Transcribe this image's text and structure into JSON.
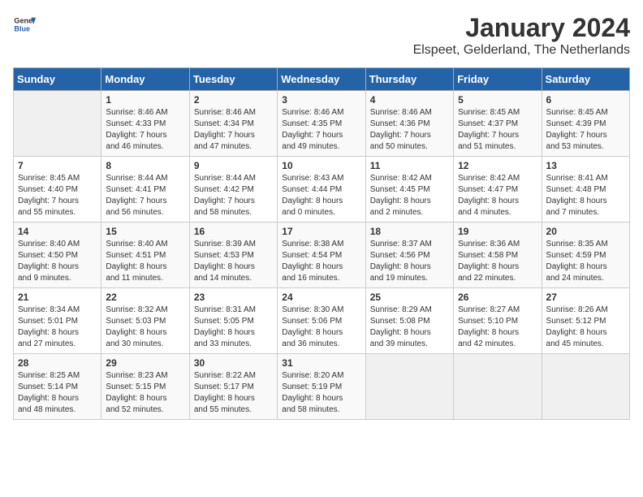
{
  "header": {
    "logo_general": "General",
    "logo_blue": "Blue",
    "month": "January 2024",
    "location": "Elspeet, Gelderland, The Netherlands"
  },
  "days_of_week": [
    "Sunday",
    "Monday",
    "Tuesday",
    "Wednesday",
    "Thursday",
    "Friday",
    "Saturday"
  ],
  "weeks": [
    [
      {
        "day": "",
        "info": ""
      },
      {
        "day": "1",
        "info": "Sunrise: 8:46 AM\nSunset: 4:33 PM\nDaylight: 7 hours\nand 46 minutes."
      },
      {
        "day": "2",
        "info": "Sunrise: 8:46 AM\nSunset: 4:34 PM\nDaylight: 7 hours\nand 47 minutes."
      },
      {
        "day": "3",
        "info": "Sunrise: 8:46 AM\nSunset: 4:35 PM\nDaylight: 7 hours\nand 49 minutes."
      },
      {
        "day": "4",
        "info": "Sunrise: 8:46 AM\nSunset: 4:36 PM\nDaylight: 7 hours\nand 50 minutes."
      },
      {
        "day": "5",
        "info": "Sunrise: 8:45 AM\nSunset: 4:37 PM\nDaylight: 7 hours\nand 51 minutes."
      },
      {
        "day": "6",
        "info": "Sunrise: 8:45 AM\nSunset: 4:39 PM\nDaylight: 7 hours\nand 53 minutes."
      }
    ],
    [
      {
        "day": "7",
        "info": "Sunrise: 8:45 AM\nSunset: 4:40 PM\nDaylight: 7 hours\nand 55 minutes."
      },
      {
        "day": "8",
        "info": "Sunrise: 8:44 AM\nSunset: 4:41 PM\nDaylight: 7 hours\nand 56 minutes."
      },
      {
        "day": "9",
        "info": "Sunrise: 8:44 AM\nSunset: 4:42 PM\nDaylight: 7 hours\nand 58 minutes."
      },
      {
        "day": "10",
        "info": "Sunrise: 8:43 AM\nSunset: 4:44 PM\nDaylight: 8 hours\nand 0 minutes."
      },
      {
        "day": "11",
        "info": "Sunrise: 8:42 AM\nSunset: 4:45 PM\nDaylight: 8 hours\nand 2 minutes."
      },
      {
        "day": "12",
        "info": "Sunrise: 8:42 AM\nSunset: 4:47 PM\nDaylight: 8 hours\nand 4 minutes."
      },
      {
        "day": "13",
        "info": "Sunrise: 8:41 AM\nSunset: 4:48 PM\nDaylight: 8 hours\nand 7 minutes."
      }
    ],
    [
      {
        "day": "14",
        "info": "Sunrise: 8:40 AM\nSunset: 4:50 PM\nDaylight: 8 hours\nand 9 minutes."
      },
      {
        "day": "15",
        "info": "Sunrise: 8:40 AM\nSunset: 4:51 PM\nDaylight: 8 hours\nand 11 minutes."
      },
      {
        "day": "16",
        "info": "Sunrise: 8:39 AM\nSunset: 4:53 PM\nDaylight: 8 hours\nand 14 minutes."
      },
      {
        "day": "17",
        "info": "Sunrise: 8:38 AM\nSunset: 4:54 PM\nDaylight: 8 hours\nand 16 minutes."
      },
      {
        "day": "18",
        "info": "Sunrise: 8:37 AM\nSunset: 4:56 PM\nDaylight: 8 hours\nand 19 minutes."
      },
      {
        "day": "19",
        "info": "Sunrise: 8:36 AM\nSunset: 4:58 PM\nDaylight: 8 hours\nand 22 minutes."
      },
      {
        "day": "20",
        "info": "Sunrise: 8:35 AM\nSunset: 4:59 PM\nDaylight: 8 hours\nand 24 minutes."
      }
    ],
    [
      {
        "day": "21",
        "info": "Sunrise: 8:34 AM\nSunset: 5:01 PM\nDaylight: 8 hours\nand 27 minutes."
      },
      {
        "day": "22",
        "info": "Sunrise: 8:32 AM\nSunset: 5:03 PM\nDaylight: 8 hours\nand 30 minutes."
      },
      {
        "day": "23",
        "info": "Sunrise: 8:31 AM\nSunset: 5:05 PM\nDaylight: 8 hours\nand 33 minutes."
      },
      {
        "day": "24",
        "info": "Sunrise: 8:30 AM\nSunset: 5:06 PM\nDaylight: 8 hours\nand 36 minutes."
      },
      {
        "day": "25",
        "info": "Sunrise: 8:29 AM\nSunset: 5:08 PM\nDaylight: 8 hours\nand 39 minutes."
      },
      {
        "day": "26",
        "info": "Sunrise: 8:27 AM\nSunset: 5:10 PM\nDaylight: 8 hours\nand 42 minutes."
      },
      {
        "day": "27",
        "info": "Sunrise: 8:26 AM\nSunset: 5:12 PM\nDaylight: 8 hours\nand 45 minutes."
      }
    ],
    [
      {
        "day": "28",
        "info": "Sunrise: 8:25 AM\nSunset: 5:14 PM\nDaylight: 8 hours\nand 48 minutes."
      },
      {
        "day": "29",
        "info": "Sunrise: 8:23 AM\nSunset: 5:15 PM\nDaylight: 8 hours\nand 52 minutes."
      },
      {
        "day": "30",
        "info": "Sunrise: 8:22 AM\nSunset: 5:17 PM\nDaylight: 8 hours\nand 55 minutes."
      },
      {
        "day": "31",
        "info": "Sunrise: 8:20 AM\nSunset: 5:19 PM\nDaylight: 8 hours\nand 58 minutes."
      },
      {
        "day": "",
        "info": ""
      },
      {
        "day": "",
        "info": ""
      },
      {
        "day": "",
        "info": ""
      }
    ]
  ]
}
